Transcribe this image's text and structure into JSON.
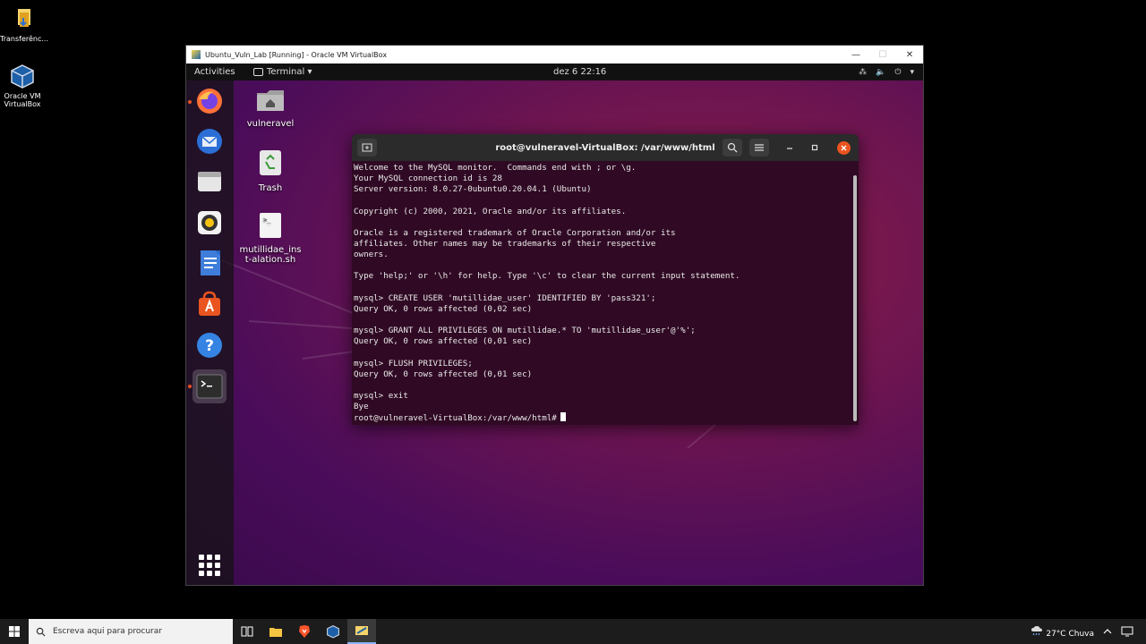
{
  "windows_desktop": {
    "icons": [
      {
        "label": "Transferênc...",
        "icon": "folder-icon"
      },
      {
        "label": "Oracle VM VirtualBox",
        "icon": "virtualbox-icon"
      }
    ]
  },
  "vbox": {
    "title": "Ubuntu_Vuln_Lab [Running] - Oracle VM VirtualBox",
    "minimize": "—",
    "maximize": "☐",
    "close": "✕"
  },
  "ubuntu_topbar": {
    "activities": "Activities",
    "app_menu": "Terminal ▾",
    "clock": "dez 6  22:16",
    "tray": [
      "⁂",
      "🔈",
      "⏻",
      "▾"
    ]
  },
  "desktop_icons": [
    {
      "label": "vulneravel",
      "icon": "home-folder-icon"
    },
    {
      "label": "Trash",
      "icon": "trash-icon"
    },
    {
      "label": "mutillidae_inst-alation.sh",
      "icon": "script-file-icon"
    }
  ],
  "dock": {
    "items": [
      "firefox",
      "thunderbird",
      "files",
      "rhythmbox",
      "libreoffice-writer",
      "ubuntu-software",
      "help",
      "terminal"
    ]
  },
  "terminal": {
    "title": "root@vulneravel-VirtualBox: /var/www/html",
    "lines": [
      "Welcome to the MySQL monitor.  Commands end with ; or \\g.",
      "Your MySQL connection id is 28",
      "Server version: 8.0.27-0ubuntu0.20.04.1 (Ubuntu)",
      "",
      "Copyright (c) 2000, 2021, Oracle and/or its affiliates.",
      "",
      "Oracle is a registered trademark of Oracle Corporation and/or its",
      "affiliates. Other names may be trademarks of their respective",
      "owners.",
      "",
      "Type 'help;' or '\\h' for help. Type '\\c' to clear the current input statement.",
      "",
      "mysql> CREATE USER 'mutillidae_user' IDENTIFIED BY 'pass321';",
      "Query OK, 0 rows affected (0,02 sec)",
      "",
      "mysql> GRANT ALL PRIVILEGES ON mutillidae.* TO 'mutillidae_user'@'%';",
      "Query OK, 0 rows affected (0,01 sec)",
      "",
      "mysql> FLUSH PRIVILEGES;",
      "Query OK, 0 rows affected (0,01 sec)",
      "",
      "mysql> exit",
      "Bye"
    ],
    "prompt": "root@vulneravel-VirtualBox:/var/www/html#"
  },
  "taskbar": {
    "search_placeholder": "Escreva aqui para procurar",
    "weather": "27°C  Chuva"
  },
  "colors": {
    "ubuntu_orange": "#e95420",
    "terminal_bg": "#300a24",
    "topbar": "#111111"
  }
}
